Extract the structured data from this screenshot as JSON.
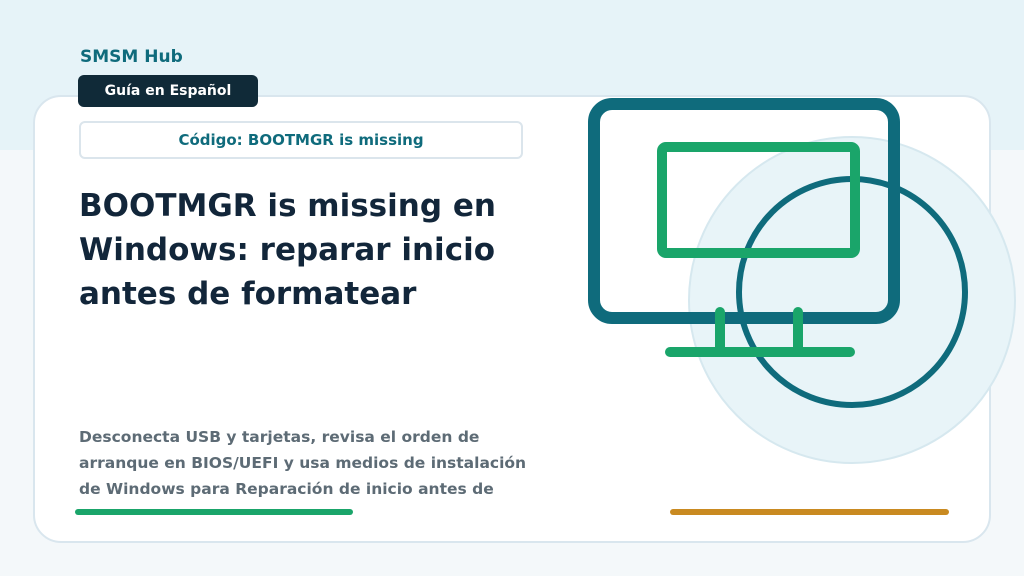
{
  "header": {
    "brand": "SMSM Hub",
    "badge": "Guía en Español",
    "code_label": "Código: BOOTMGR is missing"
  },
  "main": {
    "title": "BOOTMGR is missing en Windows: reparar inicio antes de formatear",
    "description": "Desconecta USB y tarjetas, revisa el orden de arranque en BIOS/UEFI y usa medios de instalación de Windows para Reparación de inicio antes de"
  },
  "illustration": {
    "icon": "computer-monitor-icon"
  },
  "colors": {
    "brand_teal": "#0f6b7c",
    "green": "#1aa56a",
    "orange": "#c98a21",
    "dark": "#102a38",
    "light_circle": "#e8f4f8"
  }
}
